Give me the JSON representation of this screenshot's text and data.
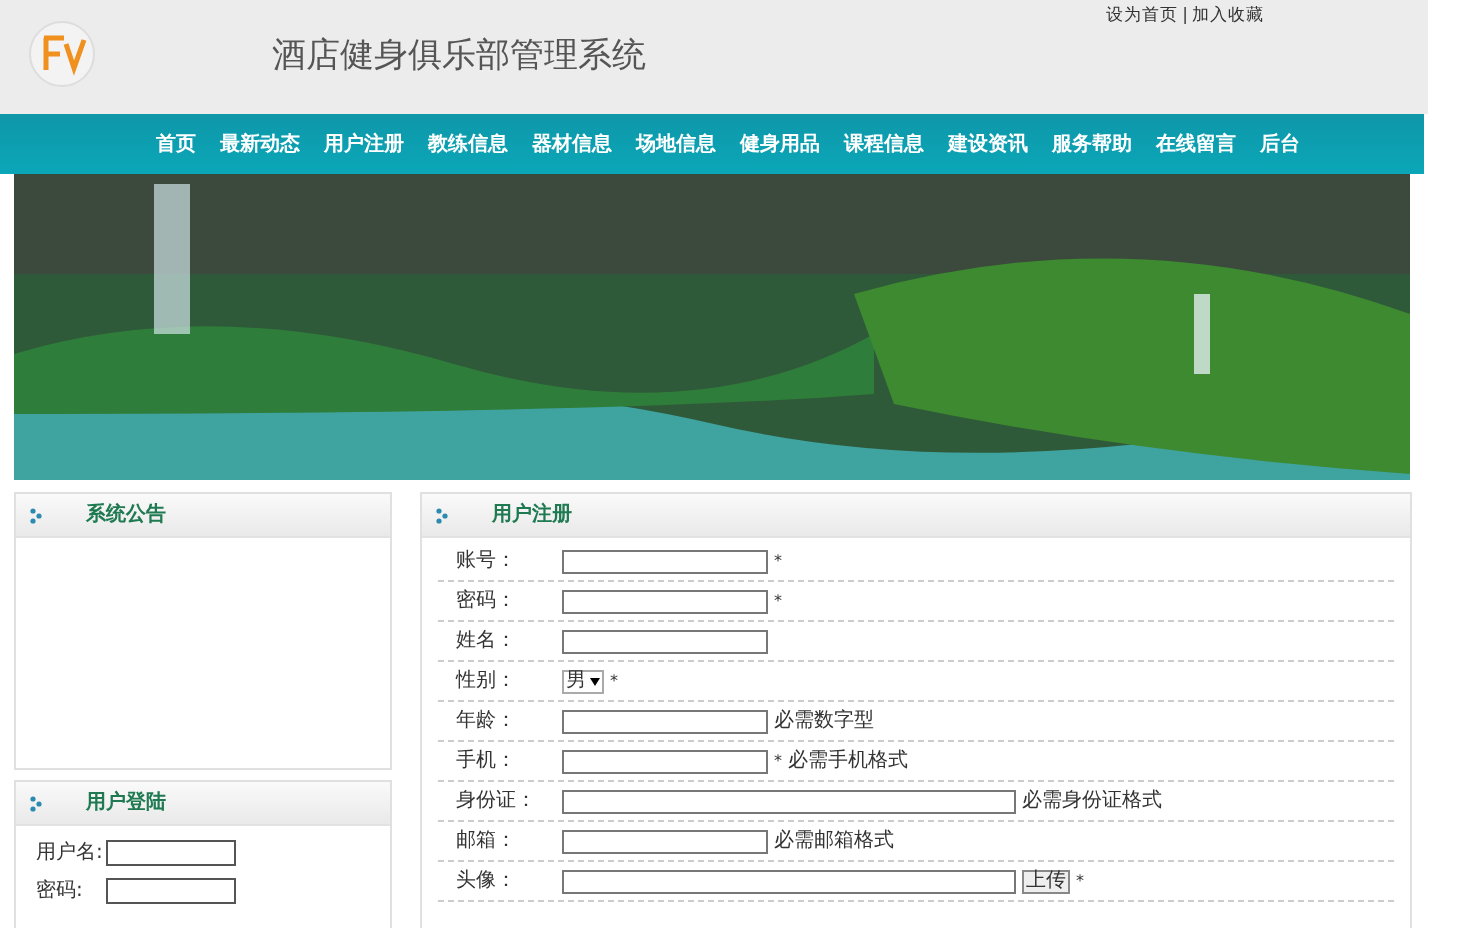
{
  "header": {
    "title": "酒店健身俱乐部管理系统",
    "top_links": [
      "设为首页",
      "加入收藏"
    ],
    "separator": "|"
  },
  "nav": {
    "items": [
      {
        "label": "首页"
      },
      {
        "label": "最新动态"
      },
      {
        "label": "用户注册"
      },
      {
        "label": "教练信息"
      },
      {
        "label": "器材信息"
      },
      {
        "label": "场地信息"
      },
      {
        "label": "健身用品"
      },
      {
        "label": "课程信息"
      },
      {
        "label": "建设资讯"
      },
      {
        "label": "服务帮助"
      },
      {
        "label": "在线留言"
      },
      {
        "label": "后台"
      }
    ]
  },
  "notice_panel": {
    "title": "系统公告"
  },
  "login_panel": {
    "title": "用户登陆",
    "fields": [
      {
        "label": "用户名:"
      },
      {
        "label": "密码:"
      }
    ]
  },
  "register_panel": {
    "title": "用户注册",
    "rows": [
      {
        "label": "账号：",
        "kind": "input",
        "mark": "*"
      },
      {
        "label": "密码：",
        "kind": "input",
        "mark": "*"
      },
      {
        "label": "姓名：",
        "kind": "input"
      },
      {
        "label": "性别：",
        "kind": "select",
        "value": "男",
        "mark": "*"
      },
      {
        "label": "年龄：",
        "kind": "input",
        "hint": "必需数字型"
      },
      {
        "label": "手机：",
        "kind": "input",
        "mark": "*",
        "hint": "必需手机格式"
      },
      {
        "label": "身份证：",
        "kind": "wide",
        "hint": "必需身份证格式"
      },
      {
        "label": "邮箱：",
        "kind": "input",
        "hint": "必需邮箱格式"
      },
      {
        "label": "头像：",
        "kind": "upload",
        "button": "上传",
        "mark": "*"
      }
    ]
  }
}
